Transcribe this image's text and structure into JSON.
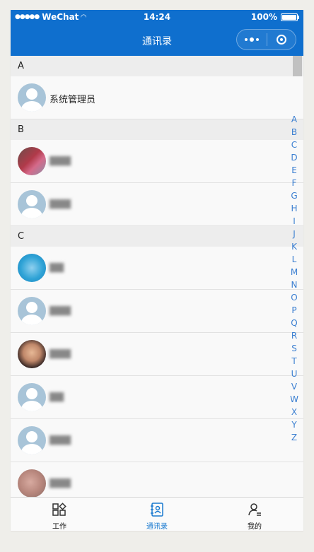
{
  "status_bar": {
    "carrier": "WeChat",
    "time": "14:24",
    "battery": "100%"
  },
  "nav": {
    "title": "通讯录"
  },
  "contacts": {
    "sections": [
      {
        "letter": "A",
        "rows": [
          {
            "name": "系统管理员"
          }
        ]
      },
      {
        "letter": "B",
        "rows": []
      },
      {
        "letter": "C",
        "rows": []
      }
    ]
  },
  "index_letters": [
    "A",
    "B",
    "C",
    "D",
    "E",
    "F",
    "G",
    "H",
    "I",
    "J",
    "K",
    "L",
    "M",
    "N",
    "O",
    "P",
    "Q",
    "R",
    "S",
    "T",
    "U",
    "V",
    "W",
    "X",
    "Y",
    "Z"
  ],
  "tabbar": {
    "tabs": [
      {
        "label": "工作",
        "icon": "grid-icon"
      },
      {
        "label": "通讯录",
        "icon": "contacts-icon"
      },
      {
        "label": "我的",
        "icon": "profile-icon"
      }
    ],
    "active_color": "#1a7ad0"
  },
  "colors": {
    "brand": "#0f6fce",
    "index_letter": "#3b7fd1"
  }
}
